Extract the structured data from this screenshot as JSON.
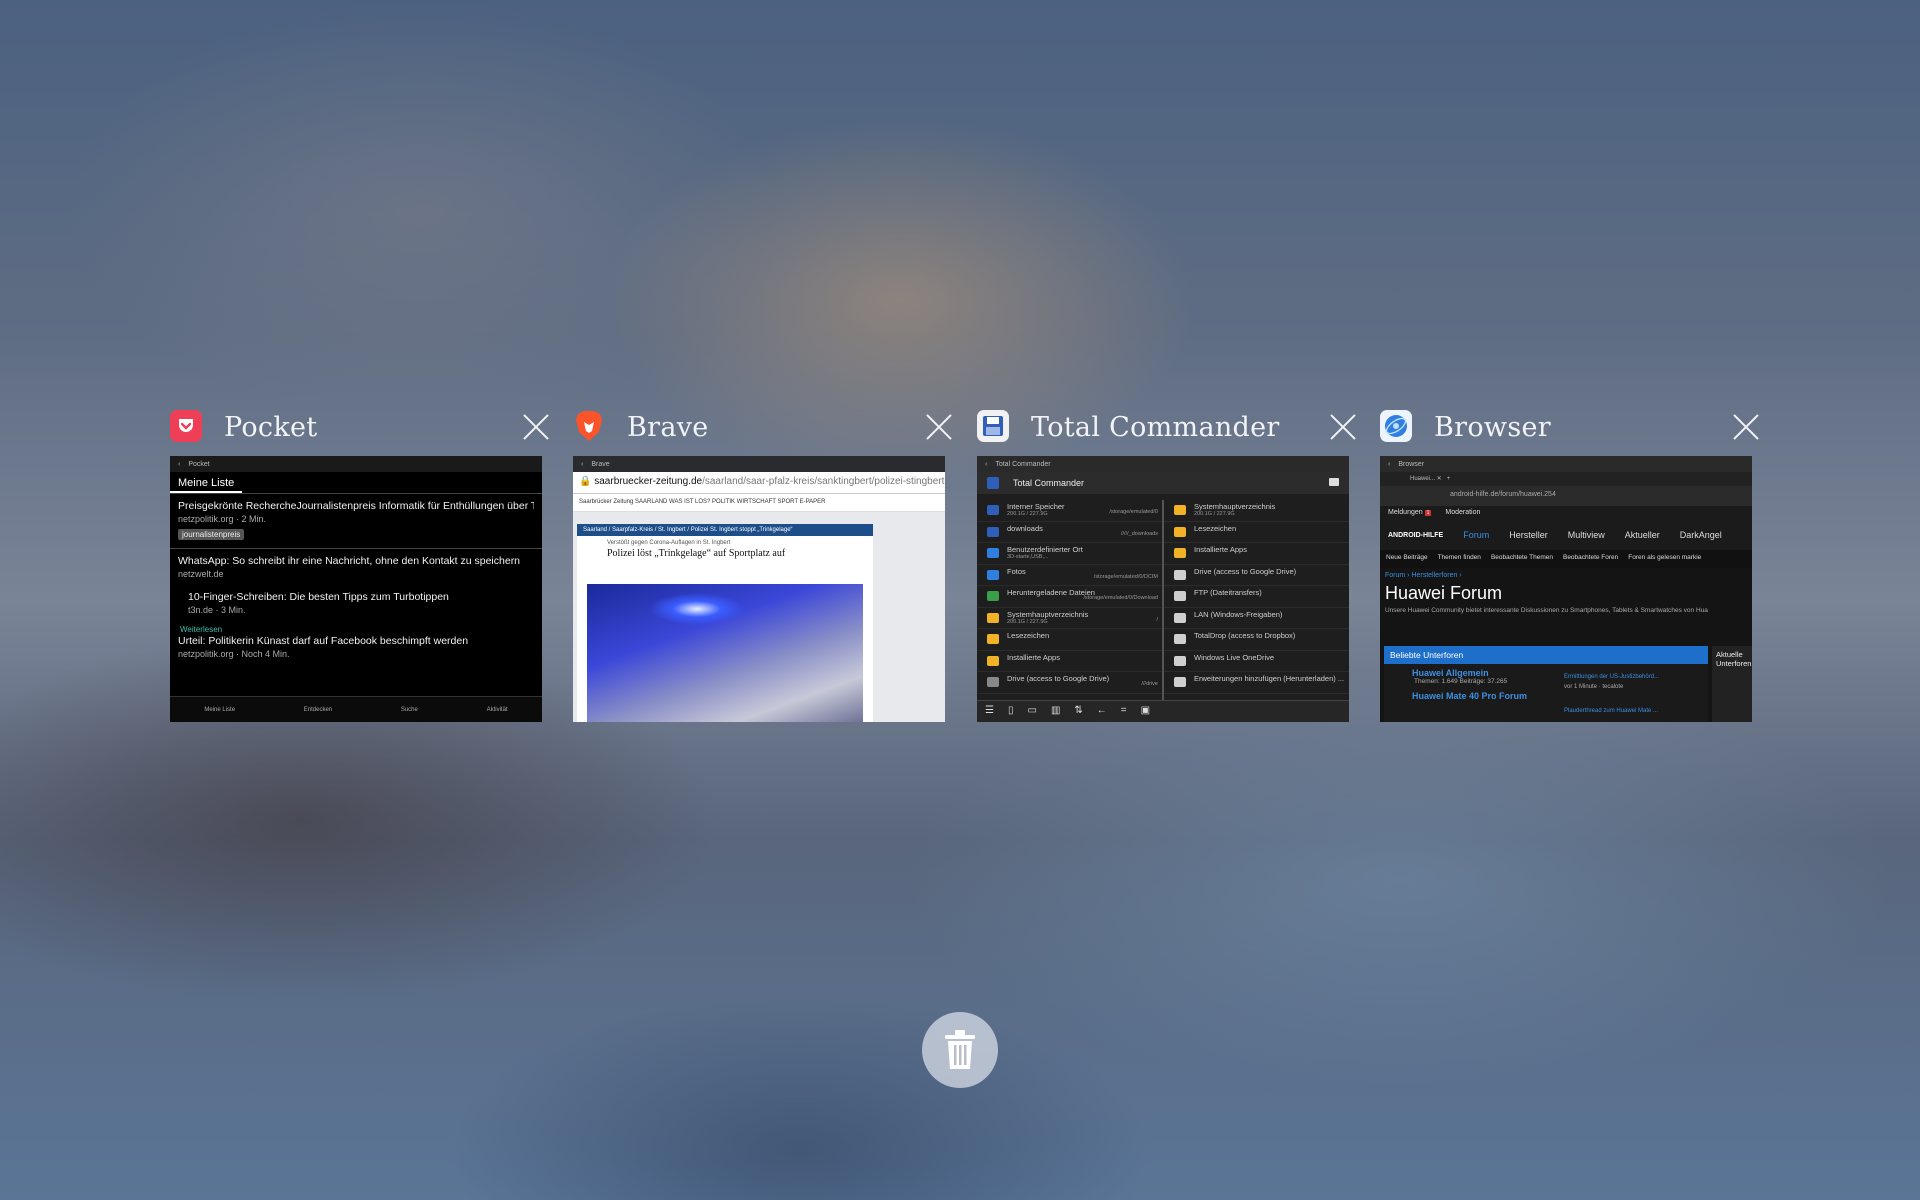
{
  "tasks": [
    {
      "app": "Pocket",
      "color": "#ef3f56",
      "icon": "pocket-icon",
      "screen": {
        "header": "Pocket",
        "list_title": "Meine Liste",
        "items": [
          {
            "title": "Preisgekrönte RechercheJournalistenpreis Informatik für Enthüllungen über TikTok",
            "meta": "netzpolitik.org · 2 Min.",
            "tag": "journalistenpreis"
          },
          {
            "title": "WhatsApp: So schreibt ihr eine Nachricht, ohne den Kontakt zu speichern",
            "meta": "netzwelt.de"
          },
          {
            "title": "10-Finger-Schreiben: Die besten Tipps zum Turbotippen",
            "meta": "t3n.de · 3 Min."
          },
          {
            "title": "Urteil: Politikerin Künast darf auf Facebook beschimpft werden",
            "meta": "netzpolitik.org · Noch 4 Min."
          }
        ],
        "continue_label": "Weiterlesen",
        "nav": [
          "Meine Liste",
          "Entdecken",
          "Suche",
          "Aktivität"
        ]
      }
    },
    {
      "app": "Brave",
      "color": "#fb542b",
      "icon": "brave-lion-icon",
      "screen": {
        "header": "Brave",
        "url_host": "saarbruecker-zeitung.de",
        "url_path": "/saarland/saar-pfalz-kreis/sanktingbert/polizei-stingbert-stoppt-tr",
        "site_nav": "Saarbrücker Zeitung    SAARLAND  WAS IST LOS?  POLITIK  WIRTSCHAFT  SPORT  E-PAPER",
        "breadcrumb": "Saarland  /  Saarpfalz-Kreis  /  St. Ingbert  /  Polizei St. Ingbert stoppt „Trinkgelage“",
        "kicker": "Verstößt gegen Corona-Auflagen in St. Ingbert",
        "headline": "Polizei löst „Trinkgelage“ auf Sportplatz auf"
      }
    },
    {
      "app": "Total Commander",
      "color": "#2f5fb8",
      "icon": "floppy-disk-icon",
      "screen": {
        "header": "Total Commander",
        "title": "Total Commander",
        "left_pane": [
          {
            "name": "Interner Speicher",
            "sub": "200.1G / 227.9G",
            "path": "/storage/emulated/0"
          },
          {
            "name": "downloads",
            "sub": "",
            "path": "/////_downloads"
          },
          {
            "name": "Benutzerdefinierter Ort",
            "sub": "3D-starte,USB,...",
            "path": ""
          },
          {
            "name": "Fotos",
            "sub": "",
            "path": "/storage/emulated/0/DCIM"
          },
          {
            "name": "Heruntergeladene Dateien",
            "sub": "",
            "path": "/storage/emulated/0/Download"
          },
          {
            "name": "Systemhauptverzeichnis",
            "sub": "200.1G / 227.9G",
            "path": "/"
          },
          {
            "name": "Lesezeichen",
            "sub": "",
            "path": ""
          },
          {
            "name": "Installierte Apps",
            "sub": "",
            "path": ""
          },
          {
            "name": "Drive (access to Google Drive)",
            "sub": "",
            "path": "///drive"
          }
        ],
        "right_pane": [
          {
            "name": "Systemhauptverzeichnis",
            "sub": "200.1G / 227.9G"
          },
          {
            "name": "Lesezeichen",
            "sub": ""
          },
          {
            "name": "Installierte Apps",
            "sub": ""
          },
          {
            "name": "Drive (access to Google Drive)",
            "sub": ""
          },
          {
            "name": "FTP (Dateitransfers)",
            "sub": ""
          },
          {
            "name": "LAN (Windows-Freigaben)",
            "sub": ""
          },
          {
            "name": "TotalDrop (access to Dropbox)",
            "sub": ""
          },
          {
            "name": "Windows Live OneDrive",
            "sub": ""
          },
          {
            "name": "Erweiterungen hinzufügen (Herunterladen) ...",
            "sub": ""
          }
        ]
      }
    },
    {
      "app": "Browser",
      "color": "#2f7fe0",
      "icon": "globe-icon",
      "screen": {
        "header": "Browser",
        "url": "android-hilfe.de/forum/huawei.254",
        "menu": [
          "Meldungen",
          "Moderation"
        ],
        "logo": "ANDROID-HILFE",
        "main_nav": [
          "Forum",
          "Hersteller",
          "Multiview",
          "Aktueller",
          "DarkAngel"
        ],
        "sub_nav": [
          "Neue Beiträge",
          "Themen finden",
          "Beobachtete Themen",
          "Beobachtete Foren",
          "Foren als gelesen markie"
        ],
        "crumbs": "Forum  ›  Herstellerforen  ›",
        "title": "Huawei Forum",
        "description": "Unsere Huawei Community bietet interessante Diskussionen zu Smartphones, Tablets & Smartwatches von Hua",
        "box_title": "Beliebte Unterforen",
        "forums": [
          {
            "name": "Huawei Allgemein",
            "meta": "Themen: 1.649  Beiträge: 37.265",
            "latest": "Ermittlungen der US-Justizbehörd...",
            "latest_meta": "vor 1 Minute · tecalote"
          },
          {
            "name": "Huawei Mate 40 Pro Forum",
            "meta": "",
            "latest": "Plauderthread zum Huawei Mate ...",
            "latest_meta": ""
          }
        ],
        "side_title": "Aktuelle Unterforen"
      }
    }
  ],
  "trash_label": "trash-icon"
}
